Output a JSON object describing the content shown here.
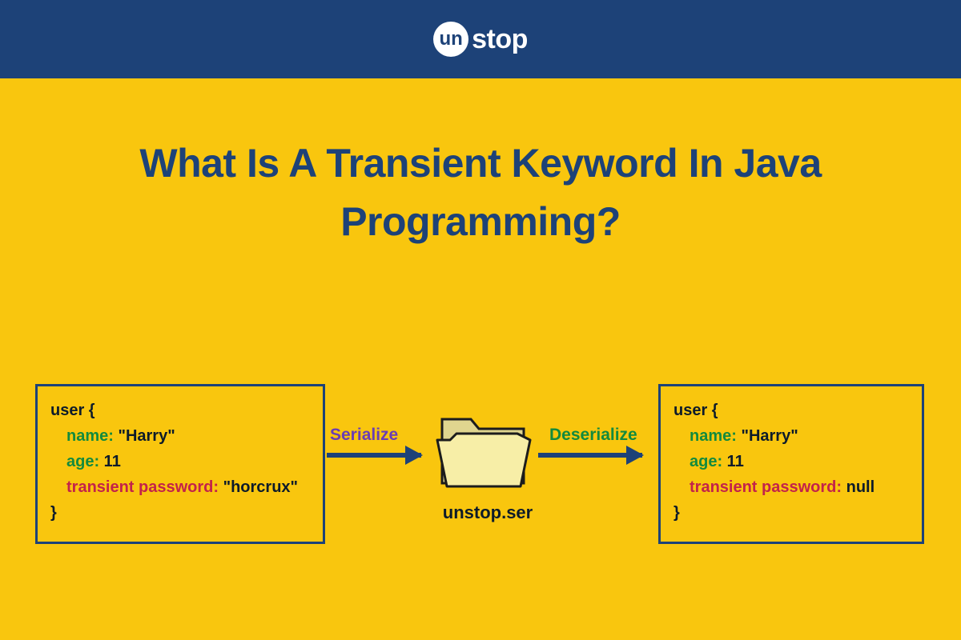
{
  "logo": {
    "circle": "un",
    "text": "stop"
  },
  "title": "What Is A Transient Keyword In Java Programming?",
  "leftBox": {
    "l1": "user {",
    "l2a": "name:",
    "l2b": " \"Harry\"",
    "l3a": "age:",
    "l3b": " 11",
    "l4a": "transient password:",
    "l4b": " \"horcrux\"",
    "l5": "}"
  },
  "rightBox": {
    "l1": "user {",
    "l2a": "name:",
    "l2b": " \"Harry\"",
    "l3a": "age:",
    "l3b": " 11",
    "l4a": "transient password:",
    "l4b": " null",
    "l5": "}"
  },
  "labels": {
    "serialize": "Serialize",
    "deserialize": "Deserialize",
    "file": "unstop.ser"
  }
}
